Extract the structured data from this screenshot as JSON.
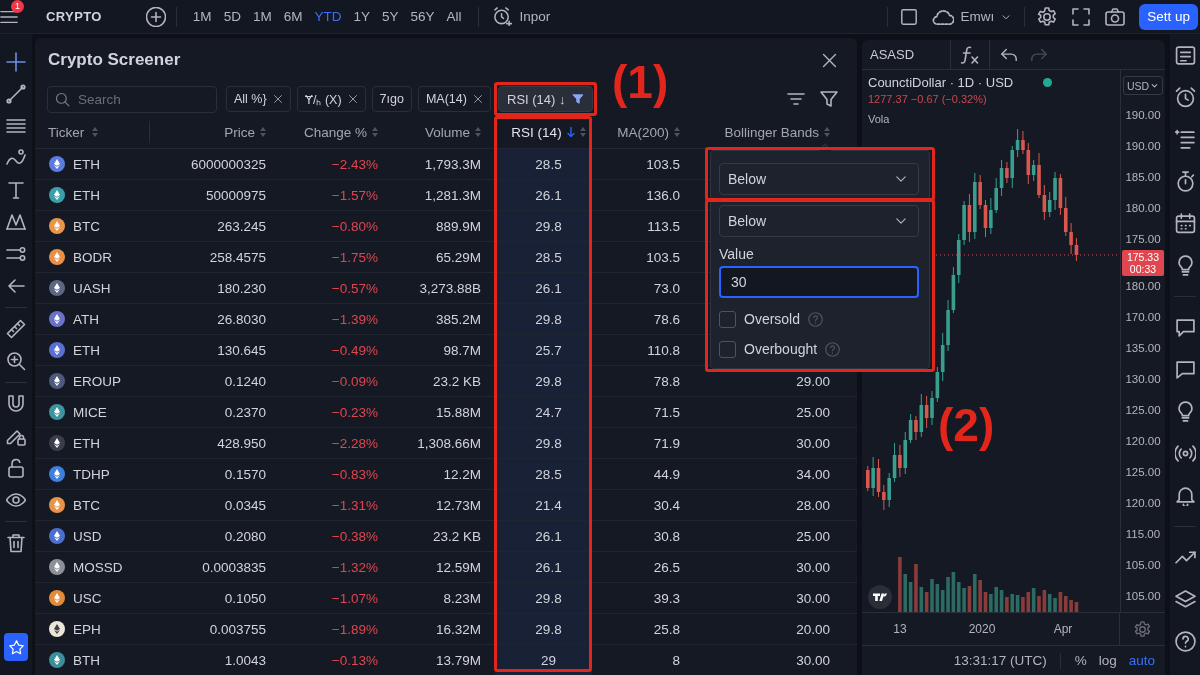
{
  "top_bar": {
    "notification_badge": "1",
    "symbol": "CRYPTO",
    "timeframes": [
      {
        "label": "1M",
        "selected": false
      },
      {
        "label": "5D",
        "selected": false
      },
      {
        "label": "1M",
        "selected": false
      },
      {
        "label": "6M",
        "selected": false
      },
      {
        "label": "YTD",
        "selected": true
      },
      {
        "label": "1Y",
        "selected": false
      },
      {
        "label": "5Y",
        "selected": false
      },
      {
        "label": "56Y",
        "selected": false
      },
      {
        "label": "All",
        "selected": false
      }
    ],
    "indicators_button": "Inpor",
    "layout_name": "Emwı",
    "setup_button": "Sett up"
  },
  "screener": {
    "title": "Crypto Screener",
    "search": {
      "placeholder": "Search"
    },
    "chips": [
      {
        "label": "All %}",
        "removable": true,
        "selected": false
      },
      {
        "label": "Ɏ/ₕ (X)",
        "removable": true,
        "selected": false
      },
      {
        "label": "7ıgo",
        "removable": false,
        "selected": false
      },
      {
        "label": "MA(14)",
        "removable": true,
        "selected": false
      },
      {
        "label": "RSI (14) ↓",
        "removable": false,
        "selected": true
      }
    ],
    "columns": [
      {
        "label": "Ticker",
        "sorted": false
      },
      {
        "label": "Price",
        "sorted": false
      },
      {
        "label": "Change %",
        "sorted": false
      },
      {
        "label": "Volume",
        "sorted": false
      },
      {
        "label": "RSI (14)",
        "sorted": true
      },
      {
        "label": "MA(200)",
        "sorted": false
      },
      {
        "label": "Bollinger Bands",
        "sorted": false
      }
    ],
    "rows": [
      {
        "ticker": "ETH",
        "color": "#5b7be0",
        "price": "6000000325",
        "change": "−2.43%",
        "negative": true,
        "volume": "1,793.3M",
        "rsi": "28.5",
        "ma200": "103.5"
      },
      {
        "ticker": "ETH",
        "color": "#3aa0a8",
        "price": "50000975",
        "change": "−1.57%",
        "negative": true,
        "volume": "1,281.3M",
        "rsi": "26.1",
        "ma200": "136.0"
      },
      {
        "ticker": "BTC",
        "color": "#e8954a",
        "price": "263.245",
        "change": "−0.80%",
        "negative": true,
        "volume": "889.9M",
        "rsi": "29.8",
        "ma200": "113.5"
      },
      {
        "ticker": "BODR",
        "color": "#e89048",
        "price": "258.4575",
        "change": "−1.75%",
        "negative": true,
        "volume": "65.29M",
        "rsi": "28.5",
        "ma200": "103.5"
      },
      {
        "ticker": "UASH",
        "color": "#5d6684",
        "price": "180.230",
        "change": "−0.57%",
        "negative": true,
        "volume": "3,273.88B",
        "rsi": "26.1",
        "ma200": "73.0"
      },
      {
        "ticker": "ATH",
        "color": "#6a72c8",
        "price": "26.8030",
        "change": "−1.39%",
        "negative": true,
        "volume": "385.2M",
        "rsi": "29.8",
        "ma200": "78.6"
      },
      {
        "ticker": "ETH",
        "color": "#5a6fd0",
        "price": "130.645",
        "change": "−0.49%",
        "negative": true,
        "volume": "98.7M",
        "rsi": "25.7",
        "ma200": "110.8"
      },
      {
        "ticker": "EROUP",
        "color": "#4d5a7e",
        "price": "0.1240",
        "change": "−0.09%",
        "negative": true,
        "volume": "23.2 KB",
        "rsi": "29.8",
        "ma200": "78.8",
        "bollinger": "29.00"
      },
      {
        "ticker": "MICE",
        "color": "#3d939e",
        "price": "0.2370",
        "change": "−0.23%",
        "negative": true,
        "volume": "15.88M",
        "rsi": "24.7",
        "ma200": "71.5",
        "bollinger": "25.00"
      },
      {
        "ticker": "ETH",
        "color": "#3a3e4b",
        "price": "428.950",
        "change": "−2.28%",
        "negative": true,
        "volume": "1,308.66M",
        "rsi": "29.8",
        "ma200": "71.9",
        "bollinger": "30.00"
      },
      {
        "ticker": "TDHP",
        "color": "#3d7fdc",
        "price": "0.1570",
        "change": "−0.83%",
        "negative": true,
        "volume": "12.2M",
        "rsi": "28.5",
        "ma200": "44.9",
        "bollinger": "34.00"
      },
      {
        "ticker": "BTC",
        "color": "#e7934a",
        "price": "0.0345",
        "change": "−1.31%",
        "negative": true,
        "volume": "12.73M",
        "rsi": "21.4",
        "ma200": "30.4",
        "bollinger": "28.00"
      },
      {
        "ticker": "USD",
        "color": "#4a6fd0",
        "price": "0.2080",
        "change": "−0.38%",
        "negative": true,
        "volume": "23.2 KB",
        "rsi": "26.1",
        "ma200": "30.8",
        "bollinger": "25.00"
      },
      {
        "ticker": "MOSSD",
        "color": "#8d9097",
        "price": "0.0003835",
        "change": "−1.32%",
        "negative": true,
        "volume": "12.59M",
        "rsi": "26.1",
        "ma200": "26.5",
        "bollinger": "30.00"
      },
      {
        "ticker": "USC",
        "color": "#e38b3b",
        "price": "0.1050",
        "change": "−1.07%",
        "negative": true,
        "volume": "8.23M",
        "rsi": "29.8",
        "ma200": "39.3",
        "bollinger": "30.00"
      },
      {
        "ticker": "EPH",
        "color": "#ece6d6",
        "price": "0.003755",
        "change": "−1.89%",
        "negative": true,
        "volume": "16.32M",
        "rsi": "29.8",
        "ma200": "25.8",
        "bollinger": "20.00"
      },
      {
        "ticker": "BTH",
        "color": "#3d8e9b",
        "price": "1.0043",
        "change": "−0.13%",
        "negative": true,
        "volume": "13.79M",
        "rsi": "29",
        "ma200": "8",
        "bollinger": "30.00"
      }
    ]
  },
  "filter_popup": {
    "conditions": [
      {
        "value": "Below"
      },
      {
        "value": "Below"
      }
    ],
    "value_label": "Value",
    "value": "30",
    "options": [
      {
        "label": "Oversold",
        "checked": false
      },
      {
        "label": "Overbought",
        "checked": false
      }
    ]
  },
  "chart": {
    "symbol": "ASASD",
    "legend": {
      "title": "CounctiDollar · 1D · USD",
      "values": "1277.37 −0.67 (−0.32%)",
      "indicator": "Vola"
    },
    "currency_button": "USD",
    "price_scale": [
      "190.00",
      "190.00",
      "185.00",
      "180.00",
      "175.00",
      "180.00",
      "170.00",
      "135.00",
      "130.00",
      "125.00",
      "120.00",
      "125.00",
      "120.00",
      "115.00",
      "105.00",
      "105.00"
    ],
    "last_price": {
      "price": "175.33",
      "countdown": "00:33"
    },
    "time_scale": [
      "13",
      "2020",
      "Apr"
    ],
    "status": {
      "time": "13:31:17 (UTC)",
      "toggles": [
        {
          "label": "%",
          "selected": false
        },
        {
          "label": "log",
          "selected": false
        },
        {
          "label": "auto",
          "selected": true
        }
      ]
    }
  },
  "annotations": [
    {
      "label": "(1)"
    },
    {
      "label": "(2)"
    }
  ]
}
